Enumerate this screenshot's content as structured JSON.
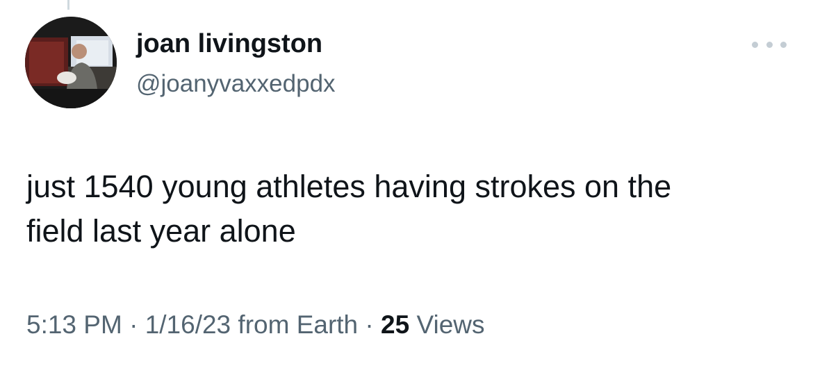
{
  "tweet": {
    "author_name": "joan livingston",
    "author_handle": "@joanyvaxxedpdx",
    "text_line1": "just 1540 young athletes having strokes on the",
    "text_line2": "field last year alone",
    "time": "5:13 PM",
    "separator": "·",
    "date": "1/16/23",
    "source": "from Earth",
    "views_count": "25",
    "views_label": "Views"
  },
  "icons": {
    "more": "more-dots-icon",
    "avatar": "profile-photo"
  },
  "colors": {
    "primary_text": "#0f1419",
    "secondary_text": "#536471",
    "thread_line": "#cfd9de",
    "background": "#ffffff"
  }
}
